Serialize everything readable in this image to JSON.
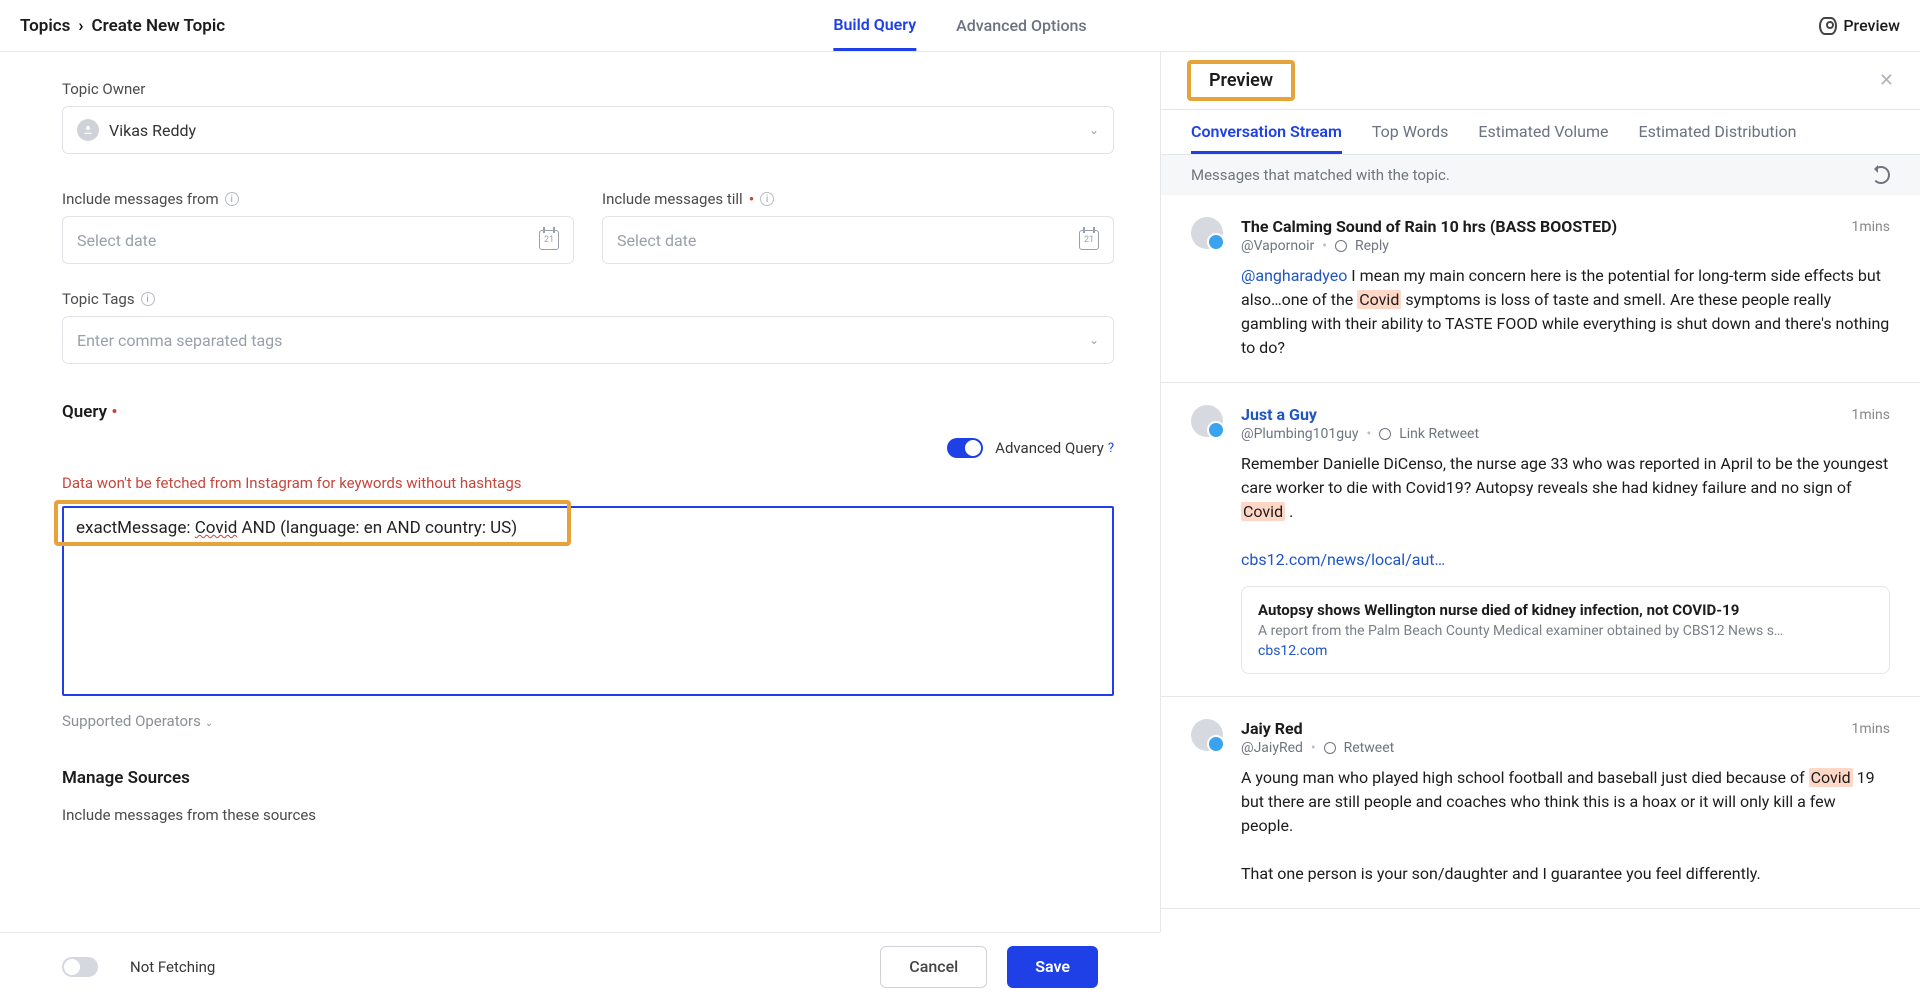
{
  "breadcrumbs": {
    "root": "Topics",
    "current": "Create New Topic"
  },
  "top_tabs": {
    "build": "Build Query",
    "advanced": "Advanced Options"
  },
  "preview_link": "Preview",
  "form": {
    "owner_label": "Topic Owner",
    "owner_value": "Vikas Reddy",
    "date_from_label": "Include messages from",
    "date_till_label": "Include messages till",
    "date_placeholder": "Select date",
    "tags_label": "Topic Tags",
    "tags_placeholder": "Enter comma separated tags",
    "query_label": "Query",
    "advanced_label": "Advanced Query",
    "warning": "Data won't be fetched from Instagram for keywords without hashtags",
    "query_value": "exactMessage: Covid AND (language: en AND country: US)",
    "supported": "Supported Operators",
    "sources_title": "Manage Sources",
    "sources_sub": "Include messages from these sources"
  },
  "footer": {
    "fetch": "Not Fetching",
    "cancel": "Cancel",
    "save": "Save"
  },
  "preview": {
    "title": "Preview",
    "tabs": {
      "stream": "Conversation Stream",
      "words": "Top Words",
      "volume": "Estimated Volume",
      "dist": "Estimated Distribution"
    },
    "matchbar": "Messages that matched with the topic.",
    "messages": [
      {
        "title": "The Calming Sound of Rain 10 hrs (BASS BOOSTED)",
        "handle": "@Vapornoir",
        "action": "Reply",
        "time": "1mins",
        "mention": "@angharadyeo",
        "pre": " I mean my main concern here is the potential for long-term side effects but also…one of the ",
        "kw": "Covid",
        "post": " symptoms is loss of taste and smell. Are these people really gambling with their ability to TASTE FOOD while everything is shut down and there's nothing to do?"
      },
      {
        "title": "Just a Guy",
        "handle": "@Plumbing101guy",
        "action": "Link Retweet",
        "time": "1mins",
        "pre": "Remember Danielle DiCenso, the nurse age 33 who was reported in April to be the youngest care worker to die with Covid19?  Autopsy reveals she had kidney failure and no sign of ",
        "kw": "Covid",
        "post": " .",
        "link": "cbs12.com/news/local/aut…",
        "card": {
          "title": "Autopsy shows Wellington nurse died of kidney infection, not COVID-19",
          "desc": "A report from the Palm Beach County Medical examiner obtained by CBS12 News s…",
          "domain": "cbs12.com"
        }
      },
      {
        "title": "Jaiy Red",
        "handle": "@JaiyRed",
        "action": "Retweet",
        "time": "1mins",
        "pre": "A young man who played high school football and baseball just died because of ",
        "kw": "Covid",
        "post": " 19 but there are still people and coaches who think this is a hoax or it will only kill a few people.",
        "para2": "That one person is your son/daughter and I guarantee you feel differently."
      }
    ]
  }
}
